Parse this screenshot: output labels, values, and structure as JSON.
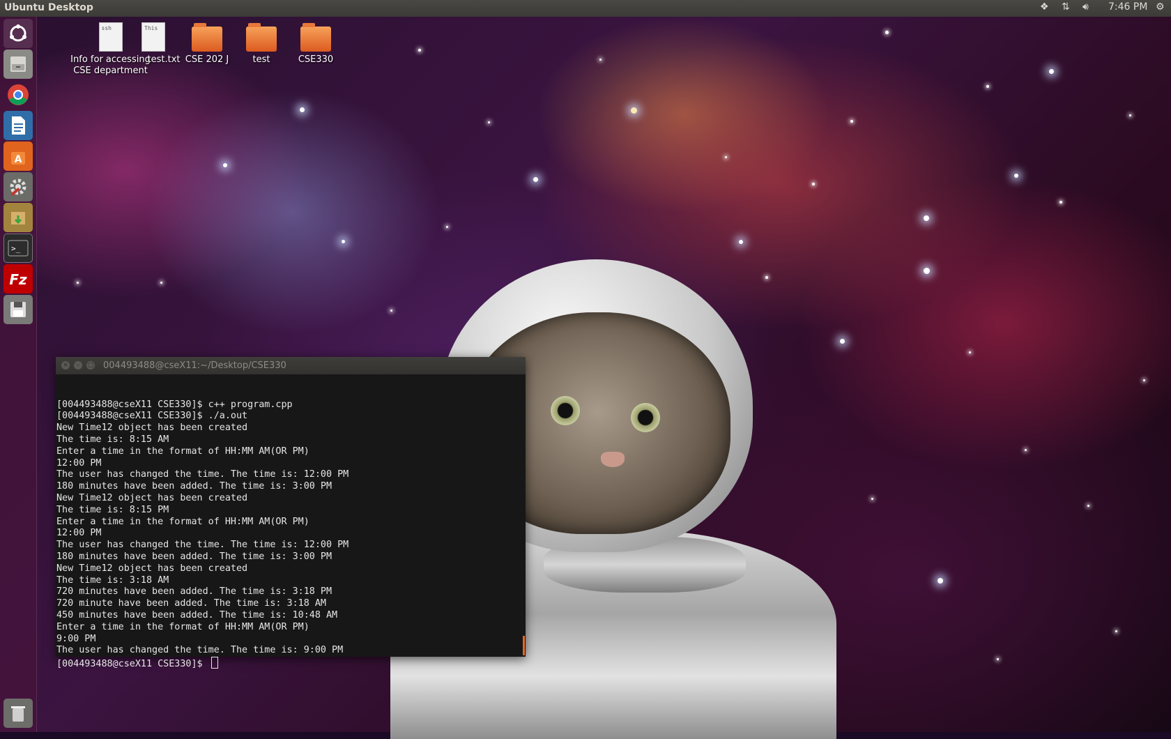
{
  "topbar": {
    "title": "Ubuntu Desktop",
    "time": "7:46 PM"
  },
  "desktop_icons": [
    {
      "label": "Info for accessing CSE department",
      "preview": "ssh"
    },
    {
      "label": "test.txt",
      "preview": "This"
    },
    {
      "label": "CSE 202 J"
    },
    {
      "label": "test"
    },
    {
      "label": "CSE330"
    }
  ],
  "launcher": {
    "items": [
      "dash-home",
      "files",
      "chrome",
      "libreoffice-writer",
      "software-center",
      "system-settings",
      "archive-manager",
      "terminal",
      "filezilla",
      "save",
      "trash"
    ]
  },
  "terminal": {
    "title": "004493488@cseX11:~/Desktop/CSE330",
    "prompt": "[004493488@cseX11 CSE330]$ ",
    "lines": [
      "[004493488@cseX11 CSE330]$ c++ program.cpp",
      "[004493488@cseX11 CSE330]$ ./a.out",
      "New Time12 object has been created",
      "The time is: 8:15 AM",
      "Enter a time in the format of HH:MM AM(OR PM)",
      "12:00 PM",
      "The user has changed the time. The time is: 12:00 PM",
      "180 minutes have been added. The time is: 3:00 PM",
      "New Time12 object has been created",
      "The time is: 8:15 PM",
      "Enter a time in the format of HH:MM AM(OR PM)",
      "12:00 PM",
      "The user has changed the time. The time is: 12:00 PM",
      "180 minutes have been added. The time is: 3:00 PM",
      "New Time12 object has been created",
      "The time is: 3:18 AM",
      "720 minutes have been added. The time is: 3:18 PM",
      "720 minute have been added. The time is: 3:18 AM",
      "450 minutes have been added. The time is: 10:48 AM",
      "Enter a time in the format of HH:MM AM(OR PM)",
      "9:00 PM",
      "The user has changed the time. The time is: 9:00 PM"
    ]
  }
}
